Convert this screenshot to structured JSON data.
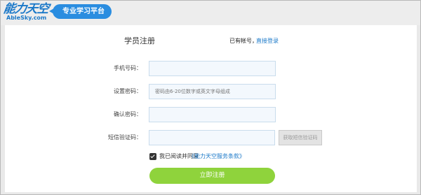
{
  "header": {
    "logo_main": "能力天空",
    "logo_sub": "AbleSky.com",
    "slogan": "专业学习平台"
  },
  "form": {
    "title": "学员注册",
    "have_account": "已有帐号，",
    "login_link": "直接登录",
    "fields": [
      {
        "label": "手机号码：",
        "placeholder": ""
      },
      {
        "label": "设置密码：",
        "placeholder": "密码由6-20位数字或英文字母组成"
      },
      {
        "label": "确认密码：",
        "placeholder": ""
      },
      {
        "label": "短信验证码：",
        "placeholder": ""
      }
    ],
    "sms_button": "获取短信验证码",
    "agree_text": "我已阅读并同意",
    "terms_link": "《能力天空服务条款》",
    "submit": "立即注册"
  }
}
